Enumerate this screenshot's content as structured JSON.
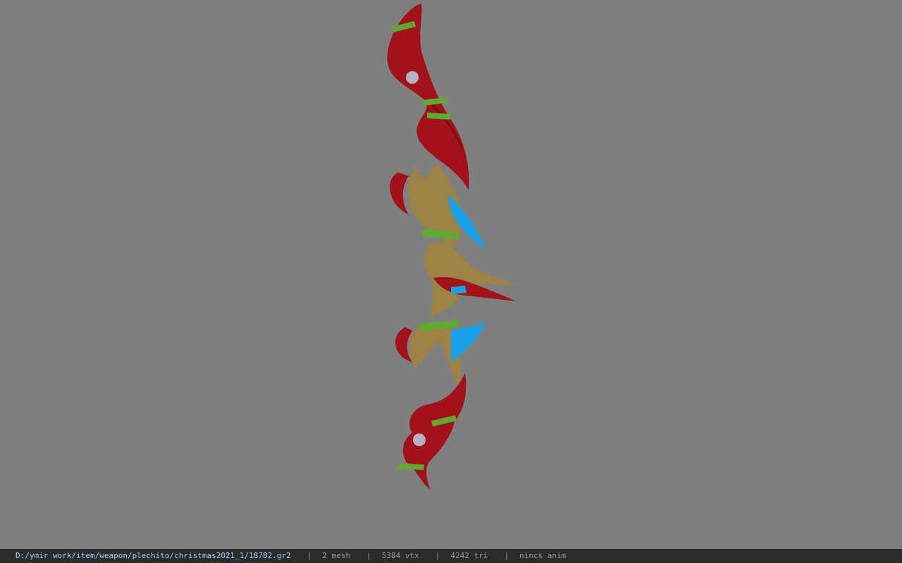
{
  "viewer": {
    "model_name": "bow-3d-model",
    "background_color": "#7f7f7f"
  },
  "status": {
    "path": "D:/ymir work/item/weapon/plechito/christmas2021_1/18782.gr2",
    "separator": "|",
    "mesh": "2 mesh",
    "vertices": "5384 vtx",
    "triangles": "4242 tri",
    "anim": "nincs anim"
  },
  "colors": {
    "red": "#a3121a",
    "gold": "#9c8243",
    "blue": "#1aa0e8",
    "green": "#5fa832"
  }
}
